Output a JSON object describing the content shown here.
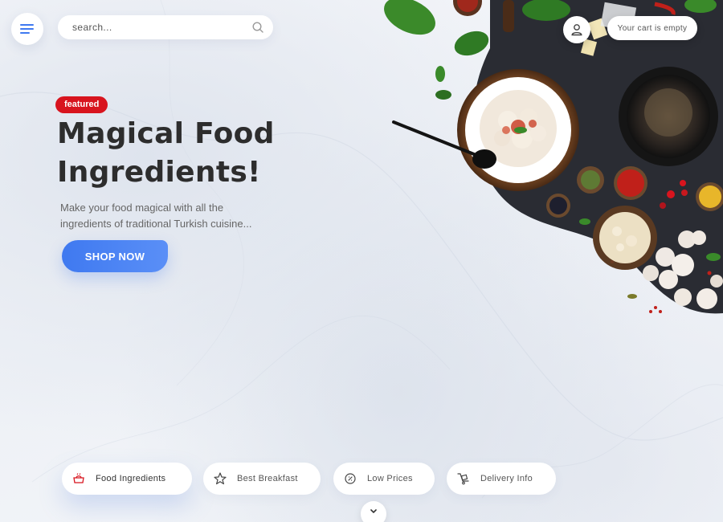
{
  "header": {
    "search": {
      "placeholder": "search...",
      "value": ""
    },
    "cart_label": "Your cart is empty"
  },
  "hero": {
    "badge": "featured",
    "title_line1": "Magical Food",
    "title_line2": "Ingredients!",
    "description": "Make your food magical with all the ingredients of traditional Turkish cuisine...",
    "cta_label": "SHOP NOW"
  },
  "features": [
    {
      "label": "Food Ingredients",
      "icon": "pot-icon",
      "active": true
    },
    {
      "label": "Best Breakfast",
      "icon": "star-icon",
      "active": false
    },
    {
      "label": "Low Prices",
      "icon": "coin-icon",
      "active": false
    },
    {
      "label": "Delivery Info",
      "icon": "delivery-icon",
      "active": false
    }
  ],
  "colors": {
    "accent": "#3f79f0",
    "badge": "#d8141e",
    "title": "#2d2d2d",
    "board": "#2a2c33"
  }
}
